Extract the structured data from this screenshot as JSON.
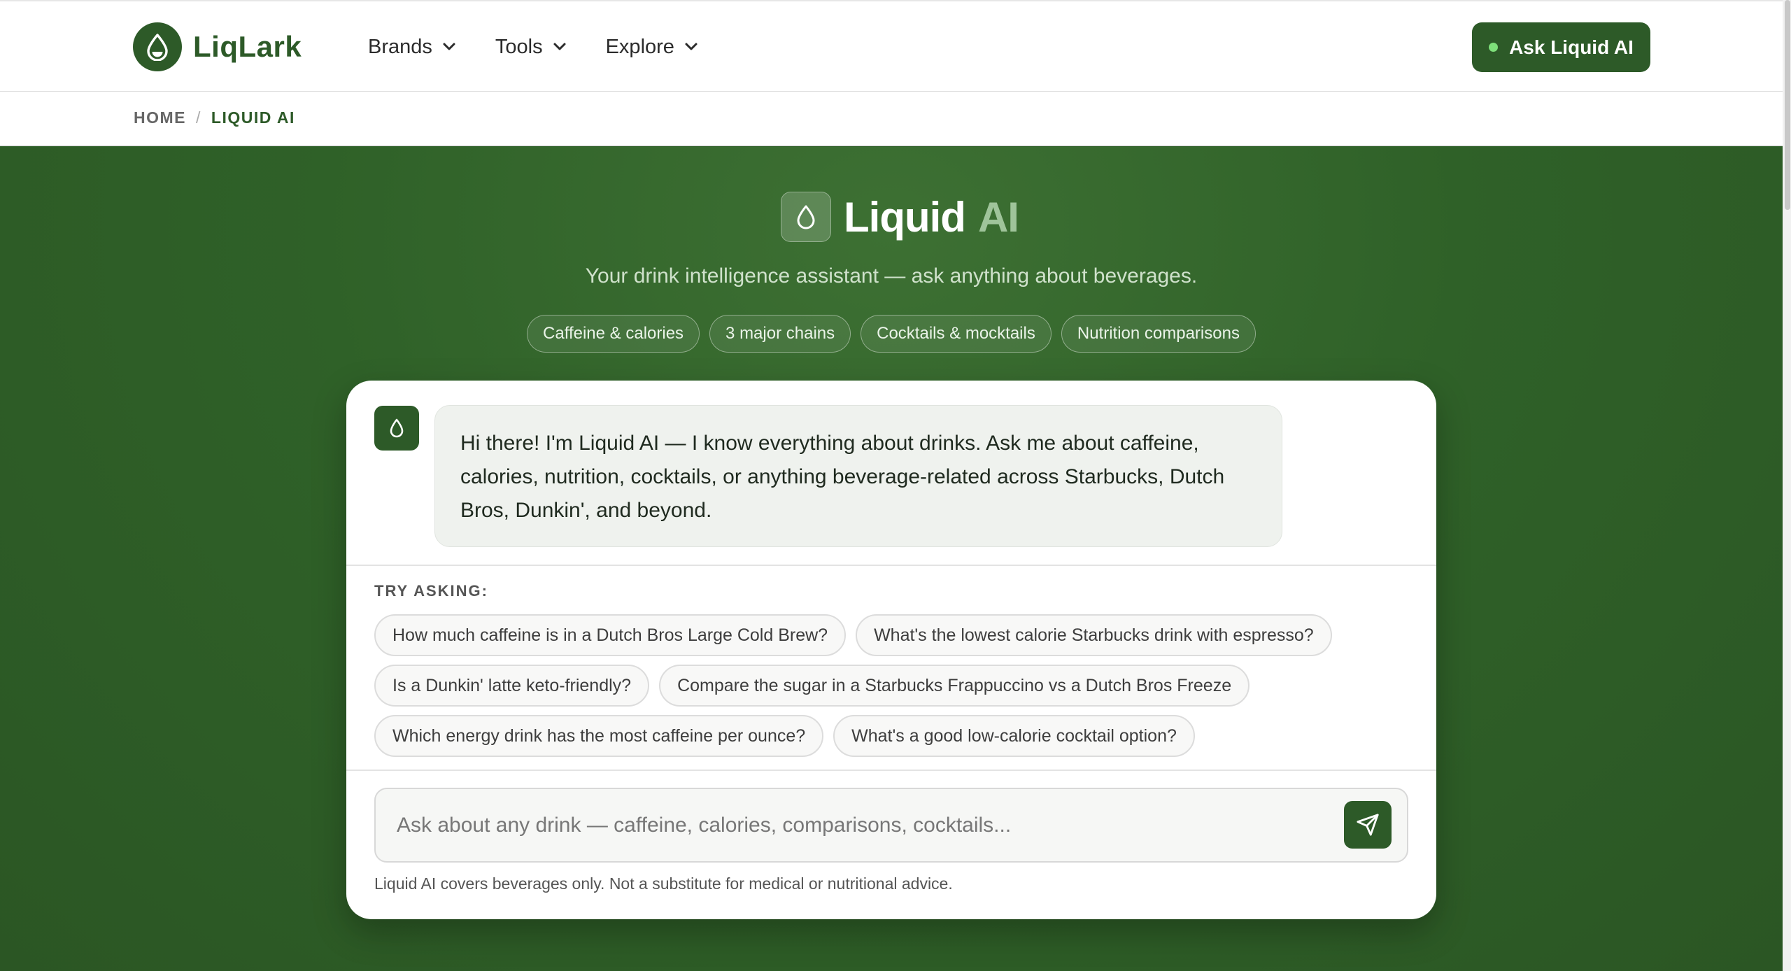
{
  "header": {
    "logo_text": "LiqLark",
    "nav": [
      {
        "label": "Brands"
      },
      {
        "label": "Tools"
      },
      {
        "label": "Explore"
      }
    ],
    "cta_label": "Ask Liquid AI"
  },
  "breadcrumb": {
    "home": "HOME",
    "separator": "/",
    "current": "LIQUID AI"
  },
  "hero": {
    "title": "Liquid",
    "title_accent": "AI",
    "subtitle": "Your drink intelligence assistant — ask anything about beverages.",
    "chips": [
      "Caffeine & calories",
      "3 major chains",
      "Cocktails & mocktails",
      "Nutrition comparisons"
    ]
  },
  "chat": {
    "greeting": "Hi there! I'm Liquid AI — I know everything about drinks. Ask me about caffeine, calories, nutrition, cocktails, or anything beverage-related across Starbucks, Dutch Bros, Dunkin', and beyond.",
    "try_label": "TRY ASKING:",
    "suggestions": [
      "How much caffeine is in a Dutch Bros Large Cold Brew?",
      "What's the lowest calorie Starbucks drink with espresso?",
      "Is a Dunkin' latte keto-friendly?",
      "Compare the sugar in a Starbucks Frappuccino vs a Dutch Bros Freeze",
      "Which energy drink has the most caffeine per ounce?",
      "What's a good low-calorie cocktail option?"
    ],
    "input_placeholder": "Ask about any drink — caffeine, calories, comparisons, cocktails...",
    "disclaimer": "Liquid AI covers beverages only. Not a substitute for medical or nutritional advice."
  },
  "colors": {
    "brand": "#2d5a28",
    "hero_bg": "#2f6128",
    "accent_text": "#9fc49a",
    "status_dot": "#7ee07a"
  }
}
